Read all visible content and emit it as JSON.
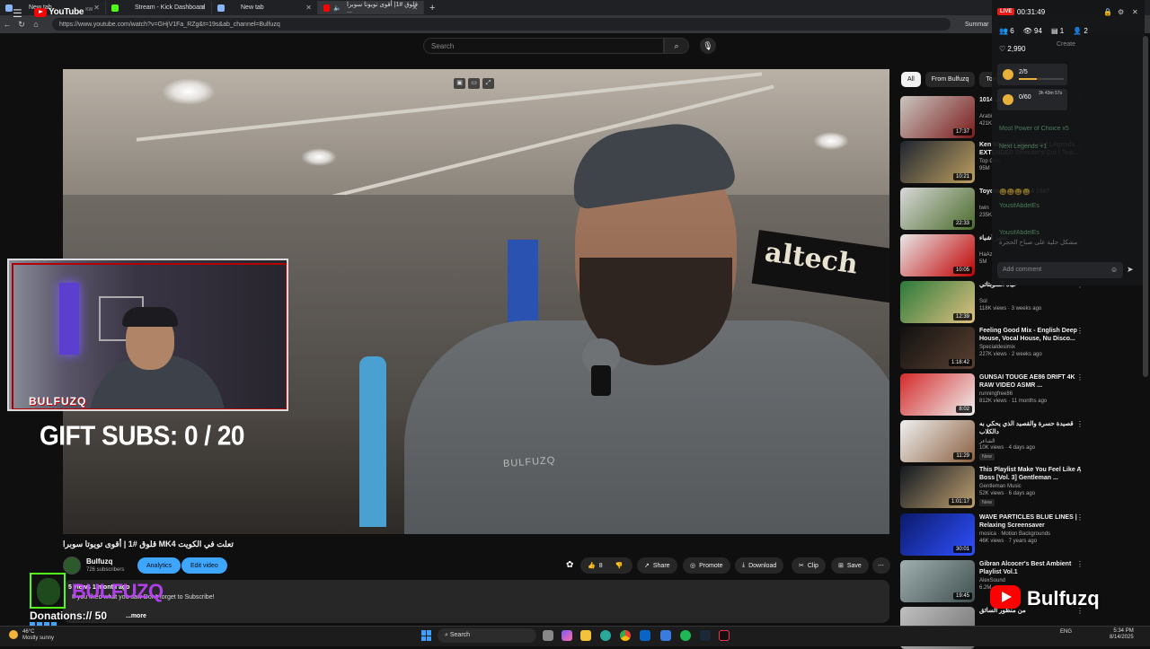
{
  "browser": {
    "tabs": [
      {
        "label": "New tab",
        "color": "#8ab4f8"
      },
      {
        "label": "Stream - Kick Dashboard",
        "color": "#53fc18"
      },
      {
        "label": "New tab",
        "color": "#8ab4f8"
      },
      {
        "label": "قلوق #1| أقوى تويوتا سوبرا ...",
        "color": "#ff0000"
      }
    ],
    "url": "https://www.youtube.com/watch?v=GHjV1Fa_RZg&t=19s&ab_channel=Bulfuzq",
    "summary_label": "Summar"
  },
  "youtube": {
    "logo_text": "YouTube",
    "logo_country": "KW",
    "search_placeholder": "Search",
    "create_label": "Create",
    "video": {
      "title": "تعلت في الكويت MK4 قلوق #1 | أقوى تويوتا سوبرا",
      "brand_on_shirt": "BULFUZQ",
      "sign_text": "altech"
    },
    "channel": {
      "name": "Bulfuzq",
      "subs": "726 subscribers"
    },
    "buttons": {
      "analytics": "Analytics",
      "edit": "Edit video",
      "likes": "8",
      "share": "Share",
      "promote": "Promote",
      "download": "Download",
      "clip": "Clip",
      "save": "Save"
    },
    "description": {
      "line1": "5 views  1 month ago",
      "line2": "If you liked what you saw Don't forget to Subscribe!",
      "more": "...more"
    },
    "chips": [
      "All",
      "From Bulfuzq",
      "Toyo"
    ],
    "recommendations": [
      {
        "title": "1014 اختبار تمارينات",
        "channel": "Arabi",
        "meta": "421K",
        "duration": "17:37",
        "colors": [
          "#c9c6c0",
          "#7b1b1b"
        ]
      },
      {
        "title": "Ken Block's Ultra Lead Legends EXTENDED Director's Cut | Top...",
        "channel": "Top Gear",
        "meta": "95M",
        "duration": "10:21",
        "colors": [
          "#1e2530",
          "#bfa060"
        ]
      },
      {
        "title": "Toyota Supra MK4 1997",
        "channel": "twin",
        "meta": "235K",
        "duration": "22:33",
        "colors": [
          "#d8d8d8",
          "#4a6b2a"
        ]
      },
      {
        "title": "عشر أشياء",
        "channel": "HaAz",
        "meta": "5M",
        "duration": "10:05",
        "colors": [
          "#e8e8e8",
          "#c00000"
        ]
      },
      {
        "title": "حياة السوبتاتي",
        "channel": "Sol",
        "meta": "118K views · 3 weeks ago",
        "duration": "12:39",
        "colors": [
          "#2a7a3a",
          "#e0c080"
        ]
      },
      {
        "title": "Feeling Good Mix - English Deep House, Vocal House, Nu Disco...",
        "channel": "Specialdesimix",
        "meta": "227K views · 2 weeks ago",
        "duration": "1:18:42",
        "colors": [
          "#111111",
          "#5a4030"
        ]
      },
      {
        "title": "GUNSAI TOUGE AE86 DRIFT 4K RAW VIDEO ASMR ...",
        "channel": "runningfree86",
        "meta": "812K views · 11 months ago",
        "duration": "8:02",
        "colors": [
          "#d42a2a",
          "#f0f0f0"
        ]
      },
      {
        "title": "قصيدة حسرة والقصيد الذي يحكي به دالكلاب",
        "channel": "الشاعر",
        "meta": "10K views · 4 days ago",
        "duration": "11:29",
        "new": "New",
        "colors": [
          "#f0f0f0",
          "#8a6040"
        ]
      },
      {
        "title": "This Playlist Make You Feel Like A Boss [Vol. 3] Gentleman ...",
        "channel": "Gentleman Music",
        "meta": "52K views · 6 days ago",
        "duration": "1:01:17",
        "new": "New",
        "colors": [
          "#101820",
          "#c0a070"
        ]
      },
      {
        "title": "WAVE PARTICLES BLUE LINES | Relaxing Screensaver",
        "channel": "mosica · Motion Backgrounds",
        "meta": "46K views · 7 years ago",
        "duration": "30:01",
        "colors": [
          "#0a1a6a",
          "#3050ff"
        ]
      },
      {
        "title": "Gibran Alcocer's Best Ambient Playlist Vol.1",
        "channel": "AlexSound",
        "meta": "6.2M",
        "duration": "19:45",
        "colors": [
          "#a0b0b0",
          "#405050"
        ]
      },
      {
        "title": "من منظور السائق",
        "channel": "",
        "meta": "",
        "duration": "",
        "colors": [
          "#c0c0c0",
          "#707070"
        ]
      }
    ]
  },
  "stream_overlay": {
    "webcam_name": "BULFUZQ",
    "gift_subs": "GIFT SUBS:  0 / 20",
    "overlay_name": "BULFUZQ",
    "donations": "Donations://   50",
    "yt_overlay_name": "Bulfuzq"
  },
  "kick_panel": {
    "live": "LIVE",
    "time": "00:31:49",
    "stats": {
      "followers_ic": "6",
      "viewers": "94",
      "subs": "1",
      "gifts": "2"
    },
    "followers_total": "2,990",
    "goal1": "2/5",
    "goal2": "0/60",
    "goal2_time": "3h 43m 57s",
    "chat_messages": [
      "Most Power of Choice x5",
      "Next Legends +1",
      "😀😀😀😀",
      "YousifAbdelEs",
      "YousifAbdelEs",
      "مشكل حلية على صباح الحجرة"
    ],
    "chat_placeholder": "Add comment"
  },
  "taskbar": {
    "weather_temp": "46°C",
    "weather_desc": "Mostly sunny",
    "search": "Search",
    "lang": "ENG",
    "time": "5:34 PM",
    "date": "8/14/2025"
  }
}
